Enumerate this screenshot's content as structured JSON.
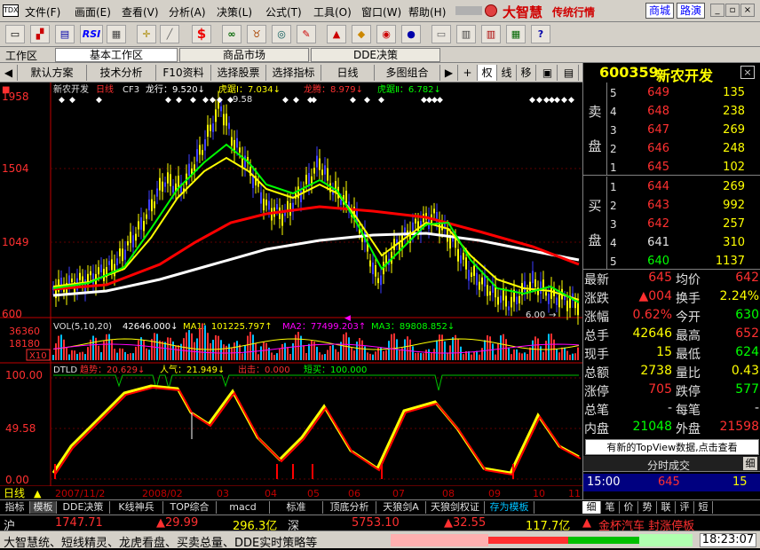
{
  "menu": {
    "logo": "TDX",
    "items": [
      "文件(F)",
      "画面(E)",
      "查看(V)",
      "分析(A)",
      "决策(L)",
      "公式(T)",
      "工具(O)",
      "窗口(W)",
      "帮助(H)"
    ],
    "brand": "大智慧",
    "brand_sub": "传统行情",
    "btn_mall": "商城",
    "btn_tour": "路演"
  },
  "toolbar": {
    "icons": [
      "open-icon",
      "kline-icon",
      "table-icon",
      "rsi-icon",
      "grid-icon",
      "crosshair-icon",
      "ruler-icon",
      "dollar-icon",
      "glasses-icon",
      "bull-icon",
      "binoculars-icon",
      "pen-icon",
      "alert-icon",
      "diamond-icon",
      "ring-icon",
      "ball-icon",
      "minimize-view-icon",
      "notes-icon",
      "books-icon",
      "calendar-icon",
      "help-cursor-icon"
    ],
    "rsi_label": "RSI"
  },
  "workspace": {
    "label": "工作区",
    "tabs": [
      "基本工作区",
      "商品市场",
      "DDE决策"
    ]
  },
  "chartbar": {
    "items": [
      "默认方案",
      "技术分析",
      "F10资料",
      "选择股票",
      "选择指标",
      "日线",
      "多图组合"
    ],
    "right_items": [
      "权",
      "线",
      "移"
    ]
  },
  "stock": {
    "code": "600359",
    "name": "新农开发"
  },
  "kline": {
    "title": "新农开发",
    "period": "日线",
    "cf": "CF3",
    "ind1": "龙行：9.520↓",
    "ind2": "虎踞Ⅰ：7.034↓",
    "ind3": "龙腾：8.979↓",
    "ind4": "虎踞Ⅱ：6.782↓",
    "high_label": "9.58",
    "low_label": "6.00",
    "axis": [
      "1958",
      "1504",
      "1049",
      "600"
    ]
  },
  "vol": {
    "title": "VOL(5,10,20)",
    "v": "42646.000↓",
    "ma1": "MA1：101225.797↑",
    "ma2": "MA2：77499.203↑",
    "ma3": "MA3：89808.852↓",
    "axis": [
      "36360",
      "18180"
    ],
    "unit": "X10"
  },
  "dtld": {
    "title": "DTLD",
    "trend": "趋势：20.629↓",
    "pop": "人气：21.949↓",
    "out": "出击：0.000",
    "short": "短买：100.000",
    "axis": [
      "100.00",
      "49.58",
      "0.00"
    ]
  },
  "dates": [
    "日线",
    "2007/11/2",
    "2008/02",
    "03",
    "04",
    "05",
    "06",
    "07",
    "08",
    "09",
    "10",
    "11"
  ],
  "orderbook": {
    "sell_label": [
      "卖",
      "盘"
    ],
    "buy_label": [
      "买",
      "盘"
    ],
    "sell": [
      {
        "n": "5",
        "p": "649",
        "v": "135"
      },
      {
        "n": "4",
        "p": "648",
        "v": "238"
      },
      {
        "n": "3",
        "p": "647",
        "v": "269"
      },
      {
        "n": "2",
        "p": "646",
        "v": "248"
      },
      {
        "n": "1",
        "p": "645",
        "v": "102"
      }
    ],
    "buy": [
      {
        "n": "1",
        "p": "644",
        "v": "269"
      },
      {
        "n": "2",
        "p": "643",
        "v": "992"
      },
      {
        "n": "3",
        "p": "642",
        "v": "257"
      },
      {
        "n": "4",
        "p": "641",
        "v": "310"
      },
      {
        "n": "5",
        "p": "640",
        "v": "1137"
      }
    ]
  },
  "quote": [
    {
      "l1": "最新",
      "v1": "645",
      "c1": "#ff3030",
      "l2": "均价",
      "v2": "642",
      "c2": "#ff3030"
    },
    {
      "l1": "涨跌",
      "v1": "▲004",
      "c1": "#ff3030",
      "l2": "换手",
      "v2": "2.24%",
      "c2": "#ffff00"
    },
    {
      "l1": "涨幅",
      "v1": "0.62%",
      "c1": "#ff3030",
      "l2": "今开",
      "v2": "630",
      "c2": "#00ff00"
    },
    {
      "l1": "总手",
      "v1": "42646",
      "c1": "#ffff00",
      "l2": "最高",
      "v2": "652",
      "c2": "#ff3030"
    },
    {
      "l1": "现手",
      "v1": "15",
      "c1": "#ffff00",
      "l2": "最低",
      "v2": "624",
      "c2": "#00ff00"
    },
    {
      "l1": "总额",
      "v1": "2738",
      "c1": "#ffff00",
      "l2": "量比",
      "v2": "0.43",
      "c2": "#ffff00"
    },
    {
      "l1": "涨停",
      "v1": "705",
      "c1": "#ff3030",
      "l2": "跌停",
      "v2": "577",
      "c2": "#00ff00"
    },
    {
      "l1": "总笔",
      "v1": "-",
      "c1": "#e0e0e0",
      "l2": "每笔",
      "v2": "-",
      "c2": "#e0e0e0"
    },
    {
      "l1": "内盘",
      "v1": "21048",
      "c1": "#00ff00",
      "l2": "外盘",
      "v2": "21598",
      "c2": "#ff3030"
    }
  ],
  "topview": "有新的TopView数据,点击查看",
  "ticks": {
    "title": "分时成交",
    "btn": "细",
    "time": "15:00",
    "price": "645",
    "vol": "15"
  },
  "bottomtabs": [
    "指标",
    "模板",
    "DDE决策",
    "K线神兵",
    "TOP综合",
    "macd",
    "标准",
    "顶底分析",
    "天狼剑A",
    "天狼剑权证",
    "存为模板"
  ],
  "righttabs": [
    "细",
    "笔",
    "价",
    "势",
    "联",
    "评",
    "短"
  ],
  "index": {
    "sh": "沪",
    "sh_val": "1747.71",
    "sh_chg": "▲29.99",
    "sh_amt": "296.3亿",
    "sz": "深",
    "sz_val": "5753.10",
    "sz_chg": "▲32.55",
    "sz_amt": "117.7亿",
    "news": "金杯汽车 封涨停板"
  },
  "status": {
    "ticker": "大智慧统、短线精灵、龙虎看盘、买卖总量、DDE实时策略等",
    "time": "18:23:07"
  }
}
